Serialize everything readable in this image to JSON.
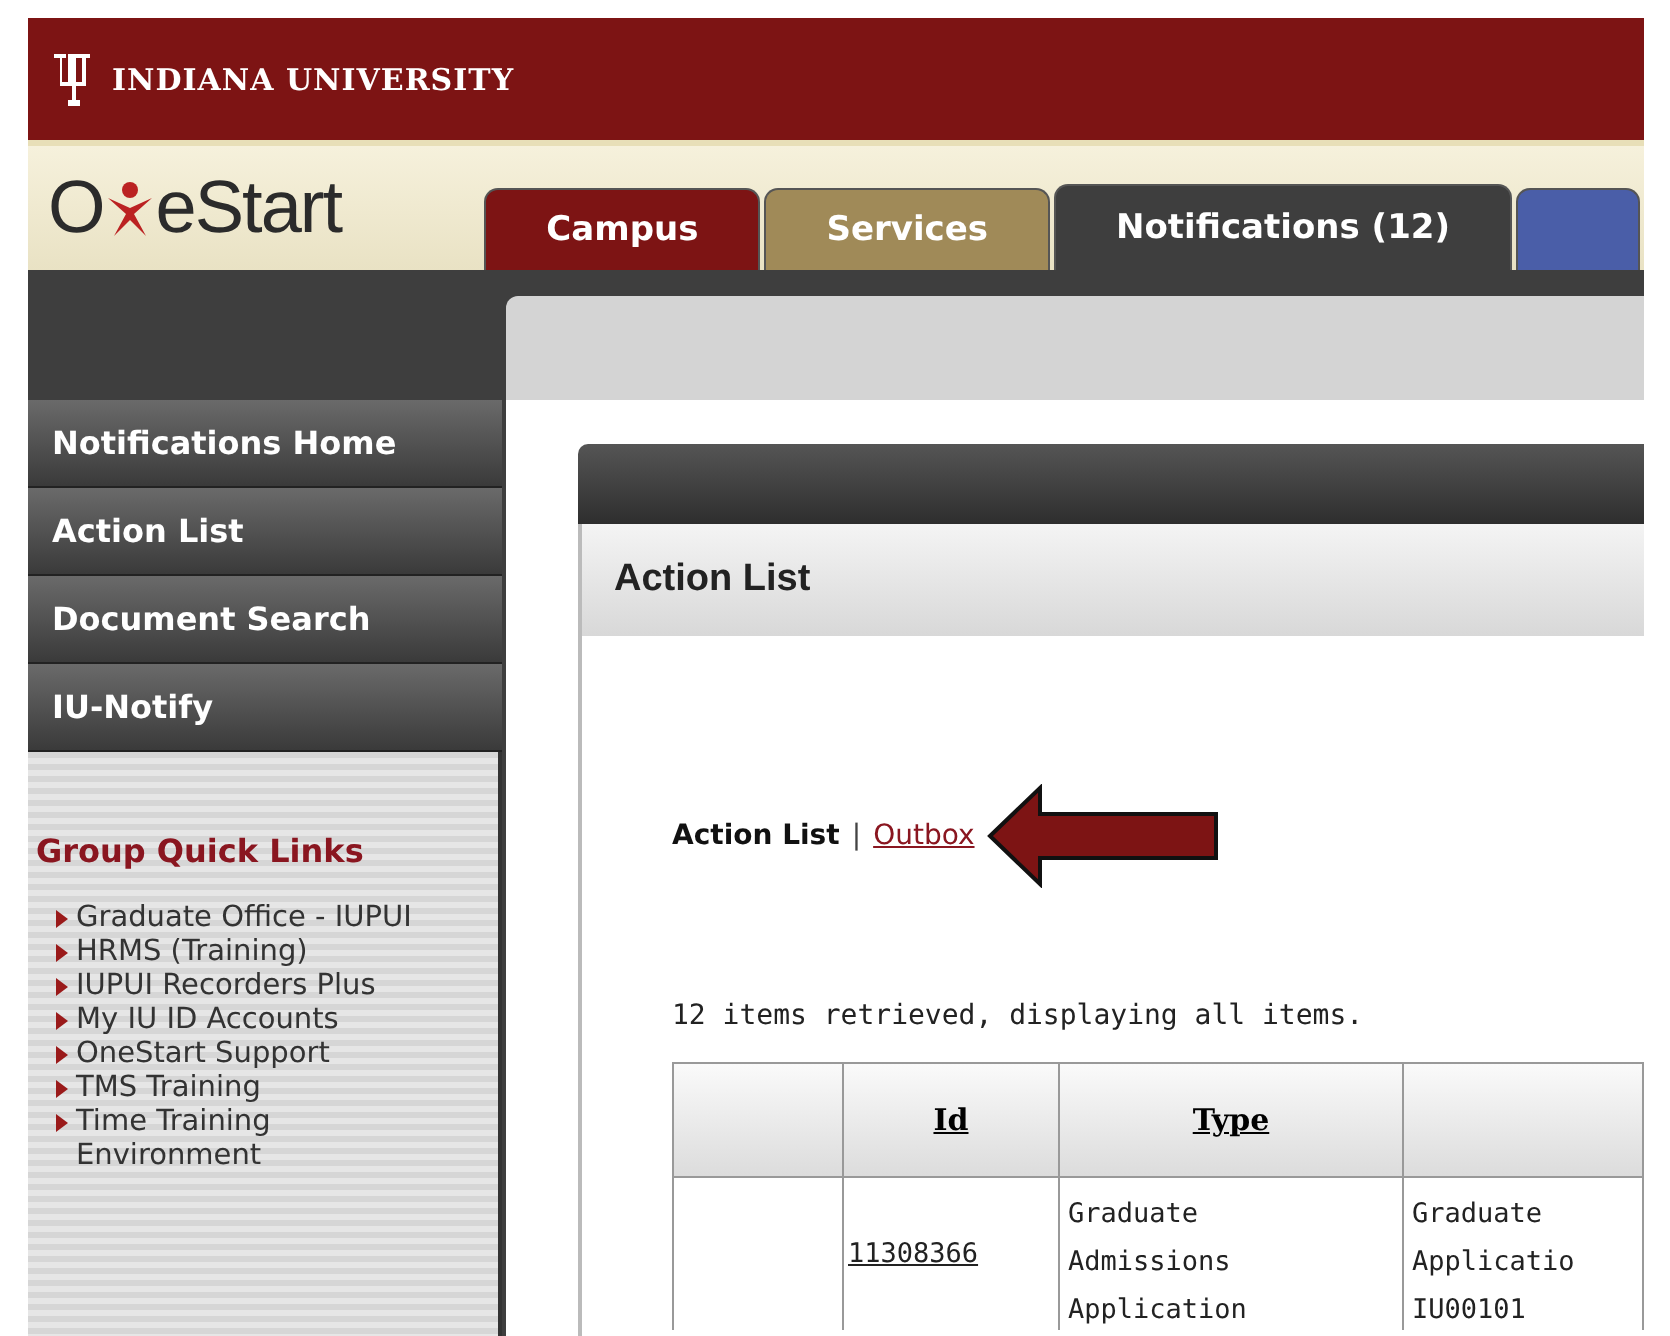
{
  "header": {
    "university": "INDIANA UNIVERSITY",
    "logo": {
      "before": "O",
      "after": "eStart"
    }
  },
  "tabs": [
    {
      "label": "Campus",
      "color": "#7d1414",
      "selected": false
    },
    {
      "label": "Services",
      "color": "#a08a58",
      "selected": false
    },
    {
      "label": "Notifications (12)",
      "color": "#3e3e3e",
      "selected": true
    },
    {
      "color": "#4a5ea8",
      "selected": false
    }
  ],
  "sidebar": {
    "items": [
      "Notifications Home",
      "Action List",
      "Document Search",
      "IU-Notify"
    ],
    "quick_links_title": "Group Quick Links",
    "quick_links": [
      [
        "Graduate Office - IUPUI"
      ],
      [
        "HRMS (Training)"
      ],
      [
        "IUPUI Recorders Plus"
      ],
      [
        "My IU ID Accounts"
      ],
      [
        "OneStart Support"
      ],
      [
        "TMS Training"
      ],
      [
        "Time Training",
        "Environment"
      ]
    ]
  },
  "panel": {
    "title": "Action List",
    "nav": {
      "current": "Action List",
      "separator": "|",
      "link": "Outbox"
    },
    "summary": "12 items retrieved, displaying all items.",
    "table": {
      "columns": [
        "Id",
        "Type"
      ],
      "rows": [
        {
          "id": "11308366",
          "type": [
            "Graduate",
            "Admissions",
            "Application"
          ],
          "column_4": [
            "Graduate",
            "Applicatio",
            "IU00101"
          ]
        }
      ]
    }
  }
}
